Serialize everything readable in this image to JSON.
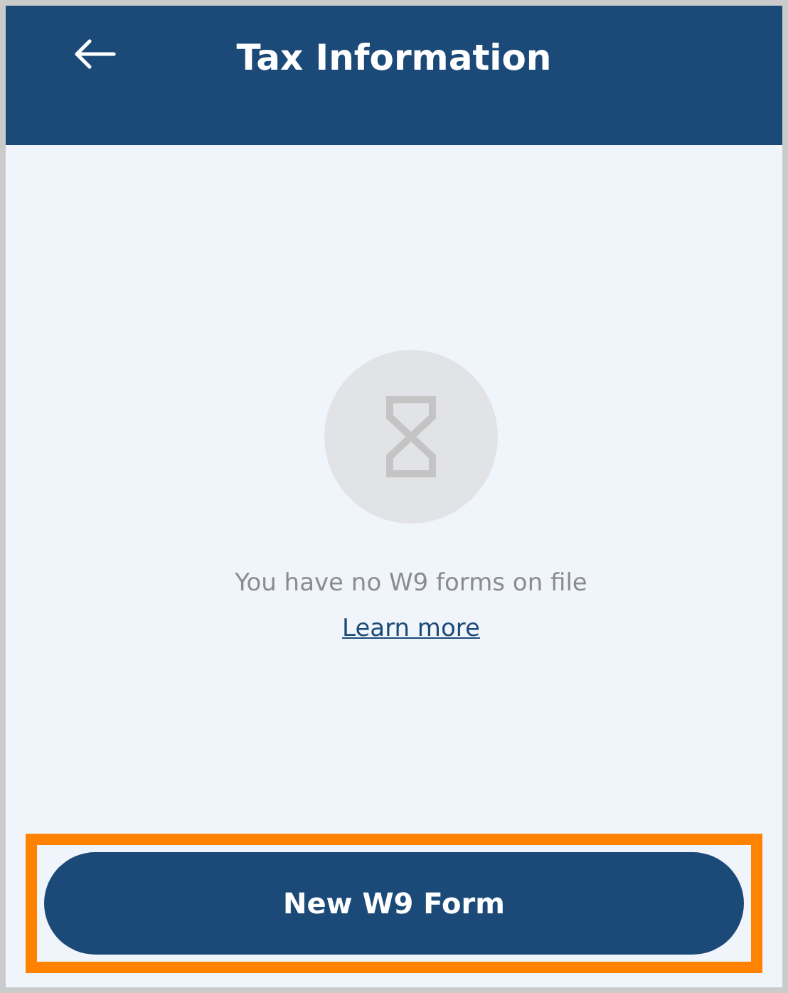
{
  "header": {
    "title": "Tax Information"
  },
  "empty_state": {
    "message": "You have no W9 forms on file",
    "link": "Learn more"
  },
  "primary_button": {
    "label": "New W9 Form",
    "highlighted": true
  }
}
